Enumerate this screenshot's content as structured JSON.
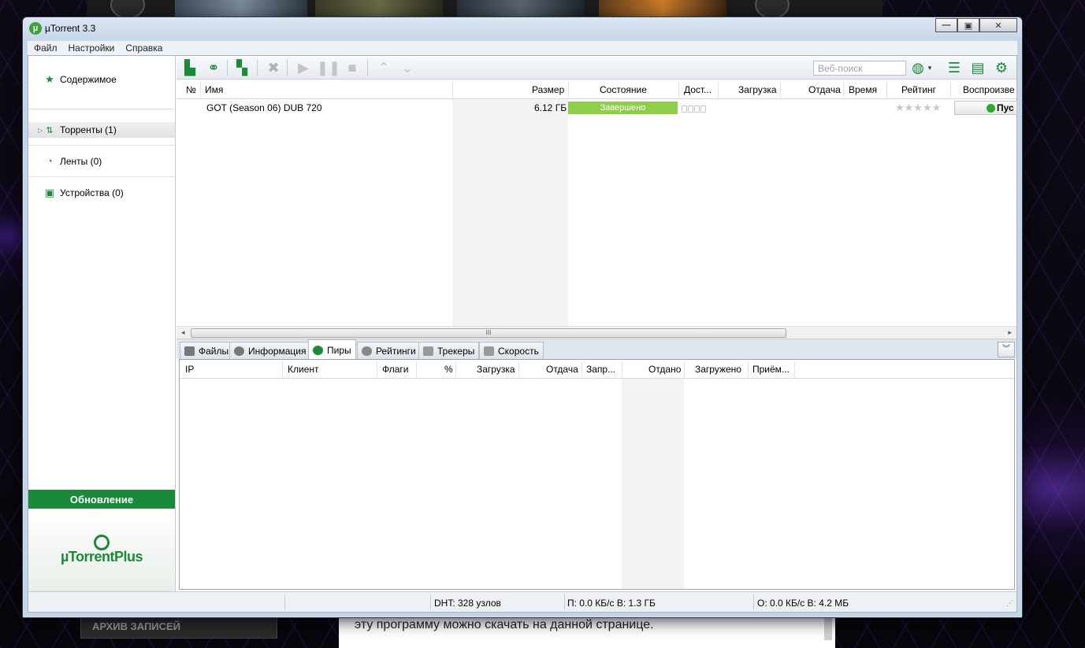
{
  "window": {
    "title": "µTorrent 3.3",
    "icon": "utorrent-logo-icon"
  },
  "menu": [
    "Файл",
    "Настройки",
    "Справка"
  ],
  "sidebar": {
    "items": [
      {
        "label": "Содержимое",
        "icon": "star-icon"
      },
      {
        "label": "Торренты (1)",
        "icon": "torrents-icon"
      },
      {
        "label": "Ленты (0)",
        "icon": "rss-icon"
      },
      {
        "label": "Устройства (0)",
        "icon": "device-icon"
      }
    ],
    "update_label": "Обновление",
    "plus_logo": "µTorrentPlus"
  },
  "toolbar": {
    "search_placeholder": "Веб-поиск",
    "buttons": [
      "add-torrent",
      "add-link",
      "create-torrent",
      "remove",
      "start",
      "pause",
      "stop",
      "move-up",
      "move-down",
      "search-engine",
      "list-view",
      "remote",
      "settings"
    ]
  },
  "torrent_list": {
    "columns": [
      "№",
      "Имя",
      "Размер",
      "Состояние",
      "Дост...",
      "Загрузка",
      "Отдача",
      "Время",
      "Рейтинг",
      "Воспроизве"
    ],
    "rows": [
      {
        "name": "GOT (Season 06) DUB 720",
        "size": "6.12 ГБ",
        "status": "Завершено",
        "rating": "★★★★★",
        "play": "Пус"
      }
    ],
    "scroll_grip": "III"
  },
  "tabs": [
    "Файлы",
    "Информация",
    "Пиры",
    "Рейтинги",
    "Трекеры",
    "Скорость"
  ],
  "active_tab": "Пиры",
  "peers": {
    "columns": [
      "IP",
      "Клиент",
      "Флаги",
      "%",
      "Загрузка",
      "Отдача",
      "Запр...",
      "Отдано",
      "Загружено",
      "Приём..."
    ]
  },
  "statusbar": {
    "dht": "DHT: 328 узлов",
    "download": "П: 0.0 КБ/с В: 1.3 ГБ",
    "upload": "О: 0.0 КБ/с В: 4.2 МБ"
  },
  "background": {
    "archive_button": "АРХИВ ЗАПИСЕЙ",
    "article_text": "эту программу можно скачать на данной странице."
  },
  "colors": {
    "accent": "#1a8a3a",
    "status_done": "#8fce4a"
  }
}
